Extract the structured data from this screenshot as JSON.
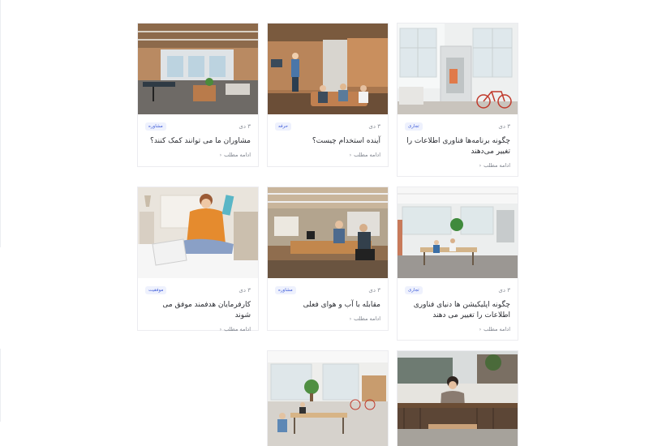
{
  "cards": [
    {
      "date": "۳ دی",
      "tag": "تجاری",
      "title": "چگونه برنامه‌ها فناوری اطلاعات را تغییر می‌دهند",
      "more": "ادامه مطلب"
    },
    {
      "date": "۳ دی",
      "tag": "حرفه",
      "title": "آینده استخدام چیست؟",
      "more": "ادامه مطلب"
    },
    {
      "date": "۳ دی",
      "tag": "مشاوره",
      "title": "مشاوران ما می توانند کمک کنند؟",
      "more": "ادامه مطلب"
    },
    {
      "date": "۳ دی",
      "tag": "تجاری",
      "title": "چگونه اپلیکیشن ها دنیای فناوری اطلاعات را تغییر می دهند",
      "more": "ادامه مطلب"
    },
    {
      "date": "۳ دی",
      "tag": "مشاوره",
      "title": "مقابله با آب و هوای فعلی",
      "more": "ادامه مطلب"
    },
    {
      "date": "۳ دی",
      "tag": "موفقیت",
      "title": "کارفرمایان هدفمند موفق می شوند",
      "more": "ادامه مطلب"
    }
  ],
  "icons": {
    "read_more": "chevron-left-icon"
  },
  "colors": {
    "tag_text": "#3d5bd9",
    "tag_bg": "#eef1fd",
    "border": "#ececf0"
  }
}
